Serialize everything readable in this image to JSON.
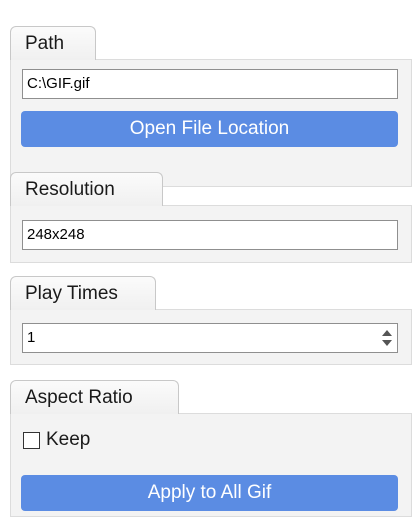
{
  "path": {
    "tab_label": "Path",
    "value": "C:\\GIF.gif",
    "open_button_label": "Open File Location"
  },
  "resolution": {
    "tab_label": "Resolution",
    "value": "248x248"
  },
  "play_times": {
    "tab_label": "Play Times",
    "value": "1"
  },
  "aspect_ratio": {
    "tab_label": "Aspect Ratio",
    "keep_label": "Keep",
    "keep_checked": false,
    "apply_button_label": "Apply to All Gif"
  },
  "colors": {
    "button_blue": "#5b8ce3",
    "panel_bg": "#f3f3f3"
  }
}
